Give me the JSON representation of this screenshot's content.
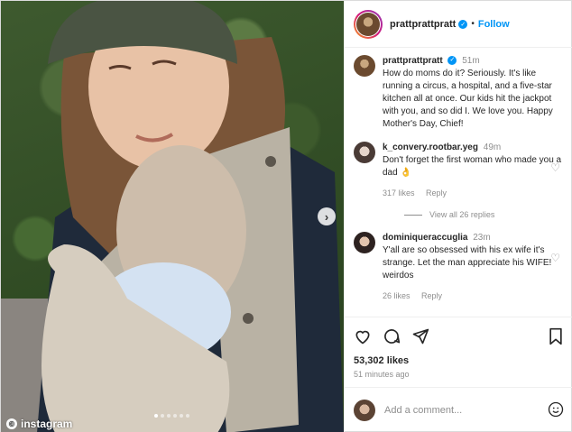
{
  "post": {
    "username": "prattprattpratt",
    "follow_label": "Follow",
    "separator": "•",
    "photo_watermark": "instagram",
    "carousel_count": 6
  },
  "caption": {
    "username": "prattprattpratt",
    "time": "51m",
    "text": "How do moms do it? Seriously. It's like running a circus, a hospital, and a five-star kitchen all at once. Our kids hit the jackpot with you, and so did I. We love you. Happy Mother's Day, Chief!"
  },
  "comments": [
    {
      "username": "k_convery.rootbar.yeg",
      "time": "49m",
      "text": "Don't forget the first woman who made you a dad 👌",
      "likes": "317 likes",
      "reply": "Reply"
    },
    {
      "username": "dominiqueraccuglia",
      "time": "23m",
      "text": "Y'all are so obsessed with his ex wife it's strange. Let the man appreciate his WIFE! weirdos",
      "likes": "26 likes",
      "reply": "Reply"
    }
  ],
  "view_all_replies": "View all 26 replies",
  "footer": {
    "likes": "53,302 likes",
    "time_ago": "51 minutes ago",
    "add_comment_placeholder": "Add a comment..."
  },
  "icons": [
    "heart-icon",
    "comment-icon",
    "share-icon",
    "bookmark-icon",
    "emoji-icon",
    "chevron-right-icon"
  ],
  "colors": {
    "link": "#0095f6",
    "muted": "#8e8e8e",
    "text": "#262626"
  }
}
